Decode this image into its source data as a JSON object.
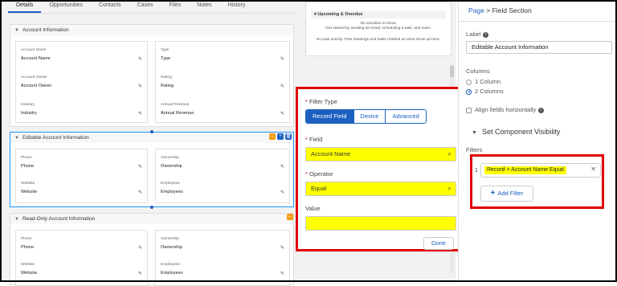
{
  "tabs": [
    "Details",
    "Opportunities",
    "Contacts",
    "Cases",
    "Files",
    "Notes",
    "History"
  ],
  "sections": {
    "account_info": {
      "title": "Account Information",
      "left": [
        {
          "label": "Account Name",
          "value": "Account Name"
        },
        {
          "label": "Account Owner",
          "value": "Account Owner"
        },
        {
          "label": "Industry",
          "value": "Industry"
        }
      ],
      "right": [
        {
          "label": "Type",
          "value": "Type"
        },
        {
          "label": "Rating",
          "value": "Rating"
        },
        {
          "label": "Annual Revenue",
          "value": "Annual Revenue"
        }
      ]
    },
    "editable_info": {
      "title": "Editable Account Information",
      "left": [
        {
          "label": "Phone",
          "value": "Phone"
        },
        {
          "label": "Website",
          "value": "Website"
        }
      ],
      "right": [
        {
          "label": "Ownership",
          "value": "Ownership"
        },
        {
          "label": "Employees",
          "value": "Employees"
        }
      ]
    },
    "readonly_info": {
      "title": "Read-Only Account Information",
      "left": [
        {
          "label": "Phone",
          "value": "Phone"
        },
        {
          "label": "Website",
          "value": "Website"
        }
      ],
      "right": [
        {
          "label": "Ownership",
          "value": "Ownership"
        },
        {
          "label": "Employees",
          "value": "Employees"
        }
      ]
    }
  },
  "activity": {
    "header": "Upcoming & Overdue",
    "empty_line1": "No activities to show.",
    "empty_line2": "Get started by sending an email, scheduling a task, and more.",
    "past": "No past activity. Past meetings and tasks marked as done show up here."
  },
  "filter_popover": {
    "filter_type_label": "Filter Type",
    "types": [
      "Record Field",
      "Device",
      "Advanced"
    ],
    "active_type": "Record Field",
    "field_label": "Field",
    "field_value": "Account Name",
    "operator_label": "Operator",
    "operator_value": "Equal",
    "value_label": "Value",
    "value_value": "",
    "done_label": "Done"
  },
  "properties": {
    "breadcrumb_parent": "Page",
    "breadcrumb_sep": ">",
    "breadcrumb_current": "Field Section",
    "label_label": "Label",
    "label_value": "Editable Account Information",
    "columns_label": "Columns",
    "column_options": [
      "1 Column",
      "2 Columns"
    ],
    "selected_columns": "2 Columns",
    "align_label": "Align fields horizontally",
    "visibility_title": "Set Component Visibility",
    "filters_label": "Filters",
    "filter_index": "1",
    "filter_text": "Record > Account Name Equal",
    "add_filter_label": "Add Filter"
  },
  "colors": {
    "accent": "#1b5fc1",
    "highlight": "#ffff00",
    "annotation": "#e00000",
    "canvas": "#f3f2f2"
  }
}
